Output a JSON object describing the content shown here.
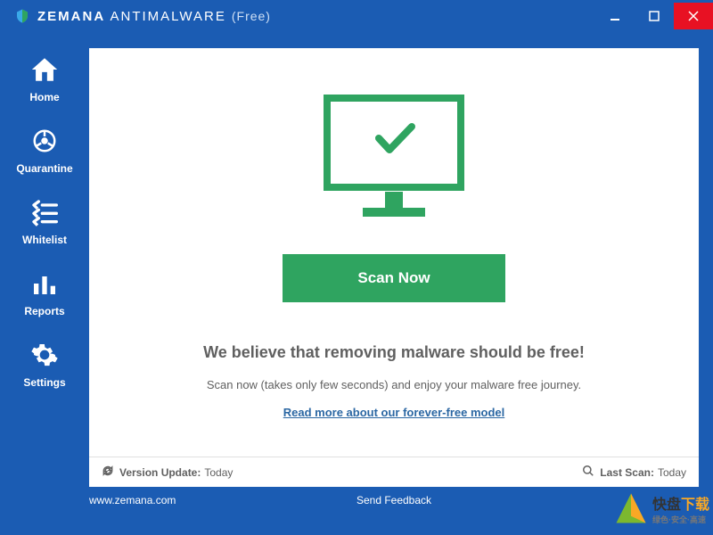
{
  "titlebar": {
    "brand_first": "ZEMANA",
    "brand_second": "ANTIMALWARE",
    "edition": "(Free)"
  },
  "sidebar": {
    "items": [
      {
        "label": "Home"
      },
      {
        "label": "Quarantine"
      },
      {
        "label": "Whitelist"
      },
      {
        "label": "Reports"
      },
      {
        "label": "Settings"
      }
    ]
  },
  "main": {
    "scan_button": "Scan Now",
    "heading": "We believe that removing malware should be free!",
    "subtext": "Scan now (takes only few seconds) and enjoy your malware free journey.",
    "read_more": "Read more about our forever-free model"
  },
  "status": {
    "version_label": "Version Update:",
    "version_value": "Today",
    "last_scan_label": "Last Scan:",
    "last_scan_value": "Today"
  },
  "footer": {
    "website": "www.zemana.com",
    "feedback": "Send Feedback"
  },
  "watermark": {
    "main": "快盘",
    "sub": "绿色·安全·高速",
    "sub2": "下载"
  },
  "colors": {
    "primary": "#1b5cb3",
    "accent": "#2fa460",
    "close": "#e81123"
  }
}
